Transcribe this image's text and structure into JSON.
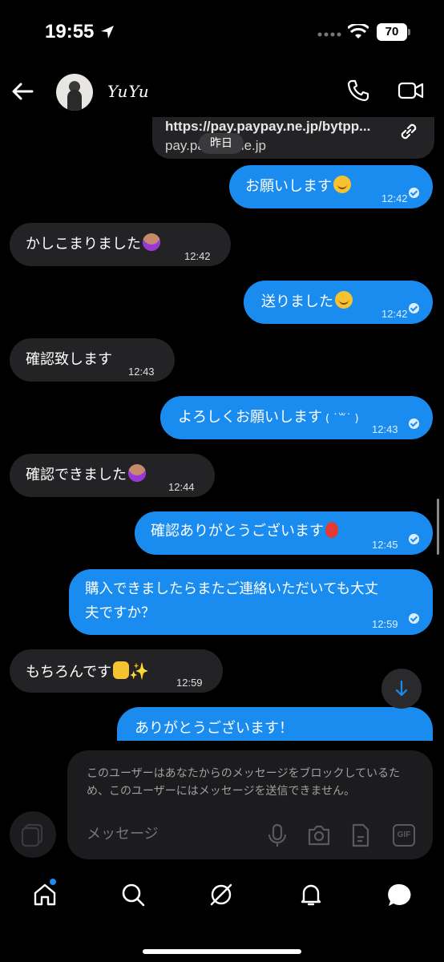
{
  "status_bar": {
    "time": "19:55",
    "battery": "70"
  },
  "header": {
    "username": "YuYu"
  },
  "link_preview": {
    "url": "https://pay.paypay.ne.jp/bytpp...",
    "domain": "pay.paypay.ne.jp",
    "date_pill": "昨日"
  },
  "messages": [
    {
      "dir": "out",
      "text": "お願いします",
      "emoji": "smile",
      "time": "12:42"
    },
    {
      "dir": "in",
      "text": "かしこまりました",
      "emoji": "person",
      "time": "12:42"
    },
    {
      "dir": "out",
      "text": "送りました",
      "emoji": "smile",
      "time": "12:42"
    },
    {
      "dir": "in",
      "text": "確認致します",
      "time": "12:43"
    },
    {
      "dir": "out",
      "text": "よろしくお願いします",
      "kaomoji": "( ˙꒳​˙ )",
      "time": "12:43"
    },
    {
      "dir": "in",
      "text": "確認できました",
      "emoji": "person",
      "time": "12:44"
    },
    {
      "dir": "out",
      "text": "確認ありがとうございます",
      "emoji": "balloon",
      "time": "12:45"
    },
    {
      "dir": "out",
      "text_line1": "購入できましたらまたご連絡いただいても大丈",
      "text_line2": "夫ですか？",
      "time": "12:59"
    },
    {
      "dir": "in",
      "text": "もちろんです",
      "emoji": "thumb-sparkles",
      "time": "12:59"
    },
    {
      "dir": "out",
      "text": "ありがとうございます！"
    }
  ],
  "composer": {
    "notice": "このユーザーはあなたからのメッセージをブロックしているため、このユーザーにはメッセージを送信できません。",
    "placeholder": "メッセージ",
    "gif_label": "GIF"
  },
  "icons": [
    "location-arrow-icon",
    "wifi-icon",
    "back-arrow-icon",
    "phone-icon",
    "video-icon",
    "link-icon",
    "scroll-down-icon",
    "gallery-icon",
    "mic-icon",
    "camera-icon",
    "document-icon",
    "gif-icon",
    "home-icon",
    "search-icon",
    "explore-icon",
    "bell-icon",
    "messages-icon"
  ],
  "colors": {
    "outgoing": "#1a8cf0",
    "incoming": "#232325",
    "background": "#000000"
  }
}
